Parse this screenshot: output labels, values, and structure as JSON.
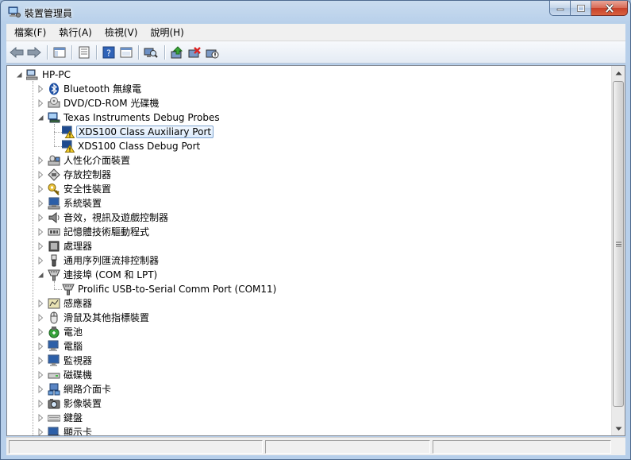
{
  "window": {
    "title": "裝置管理員",
    "caption": {
      "minimize": "minimize",
      "maximize": "maximize",
      "close": "close"
    }
  },
  "menu": [
    {
      "label": "檔案(F)"
    },
    {
      "label": "執行(A)"
    },
    {
      "label": "檢視(V)"
    },
    {
      "label": "說明(H)"
    }
  ],
  "toolbar": {
    "buttons": [
      "back-icon",
      "forward-icon",
      "show-hide-tree-icon",
      "properties-icon",
      "help-icon",
      "view-icon",
      "scan-hardware-icon",
      "update-driver-icon",
      "uninstall-icon",
      "disable-icon"
    ]
  },
  "tree": {
    "root": "HP-PC",
    "items": [
      {
        "label": "Bluetooth 無線電",
        "icon": "bluetooth-icon",
        "level": 1,
        "expanded": false
      },
      {
        "label": "DVD/CD-ROM 光碟機",
        "icon": "dvd-drive-icon",
        "level": 1,
        "expanded": false
      },
      {
        "label": "Texas Instruments Debug Probes",
        "icon": "debug-probe-icon",
        "level": 1,
        "expanded": true
      },
      {
        "label": "XDS100 Class Auxiliary Port",
        "icon": "warning-device-icon",
        "level": 2,
        "selected": true
      },
      {
        "label": "XDS100 Class Debug Port",
        "icon": "warning-device-icon",
        "level": 2
      },
      {
        "label": "人性化介面裝置",
        "icon": "hid-icon",
        "level": 1,
        "expanded": false
      },
      {
        "label": "存放控制器",
        "icon": "storage-controller-icon",
        "level": 1,
        "expanded": false
      },
      {
        "label": "安全性裝置",
        "icon": "security-key-icon",
        "level": 1,
        "expanded": false
      },
      {
        "label": "系統裝置",
        "icon": "system-device-icon",
        "level": 1,
        "expanded": false
      },
      {
        "label": "音效，視訊及遊戲控制器",
        "icon": "speaker-icon",
        "level": 1,
        "expanded": false
      },
      {
        "label": "記憶體技術驅動程式",
        "icon": "memory-icon",
        "level": 1,
        "expanded": false
      },
      {
        "label": "處理器",
        "icon": "processor-icon",
        "level": 1,
        "expanded": false
      },
      {
        "label": "通用序列匯流排控制器",
        "icon": "usb-icon",
        "level": 1,
        "expanded": false
      },
      {
        "label": "連接埠 (COM 和 LPT)",
        "icon": "port-icon",
        "level": 1,
        "expanded": true
      },
      {
        "label": "Prolific USB-to-Serial Comm Port (COM11)",
        "icon": "port-icon",
        "level": 2
      },
      {
        "label": "感應器",
        "icon": "sensor-icon",
        "level": 1,
        "expanded": false
      },
      {
        "label": "滑鼠及其他指標裝置",
        "icon": "mouse-icon",
        "level": 1,
        "expanded": false
      },
      {
        "label": "電池",
        "icon": "battery-icon",
        "level": 1,
        "expanded": false
      },
      {
        "label": "電腦",
        "icon": "computer-icon",
        "level": 1,
        "expanded": false
      },
      {
        "label": "監視器",
        "icon": "monitor-icon",
        "level": 1,
        "expanded": false
      },
      {
        "label": "磁碟機",
        "icon": "disk-drive-icon",
        "level": 1,
        "expanded": false
      },
      {
        "label": "網路介面卡",
        "icon": "network-adapter-icon",
        "level": 1,
        "expanded": false
      },
      {
        "label": "影像裝置",
        "icon": "camera-icon",
        "level": 1,
        "expanded": false
      },
      {
        "label": "鍵盤",
        "icon": "keyboard-icon",
        "level": 1,
        "expanded": false
      },
      {
        "label": "顯示卡",
        "icon": "display-adapter-icon",
        "level": 1,
        "expanded": false
      }
    ]
  }
}
